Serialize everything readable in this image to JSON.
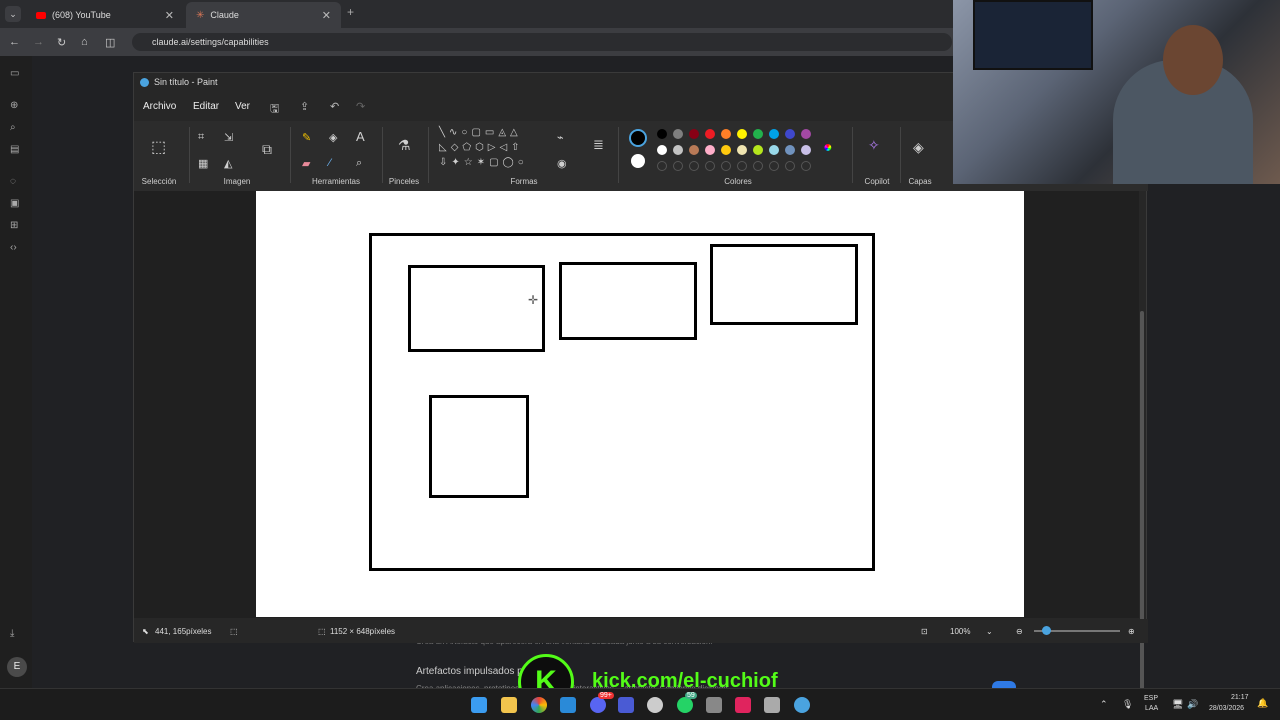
{
  "browser": {
    "tabs": [
      {
        "label": "(608) YouTube",
        "active": false
      },
      {
        "label": "Claude",
        "active": true
      }
    ],
    "url": "claude.ai/settings/capabilities"
  },
  "paint": {
    "title": "Sin título - Paint",
    "menu": [
      "Archivo",
      "Editar",
      "Ver"
    ],
    "groups": {
      "seleccion": "Selección",
      "imagen": "Imagen",
      "herramientas": "Herramientas",
      "pinceles": "Pinceles",
      "formas": "Formas",
      "colores": "Colores",
      "copilot": "Copilot",
      "capas": "Capas"
    },
    "palette_row1": [
      "#000000",
      "#7f7f7f",
      "#880015",
      "#ed1c24",
      "#ff7f27",
      "#fff200",
      "#22b14c",
      "#00a2e8",
      "#3f48cc",
      "#a349a4"
    ],
    "palette_row2": [
      "#ffffff",
      "#c3c3c3",
      "#b97a57",
      "#ffaec9",
      "#ffc90e",
      "#efe4b0",
      "#b5e61d",
      "#99d9ea",
      "#7092be",
      "#c8bfe7"
    ],
    "status": {
      "cursor_pos": "441, 165píxeles",
      "canvas_size": "1152 × 648píxeles",
      "zoom": "100%"
    }
  },
  "page_behind": {
    "line1": "Crea un Artefacto que aparecerá en una ventana dedicada junto a su conversación.",
    "heading": "Artefactos impulsados por",
    "line2": "Crea aplicaciones, prototipos y documentos interactivos… artefacto. Comience diciendo"
  },
  "overlay": {
    "kick_text": "kick.com/el-cuchiof",
    "kick_logo": "K"
  },
  "taskbar": {
    "lang_top": "ESP",
    "lang_bottom": "LAA",
    "time": "21:17",
    "date": "28/03/2026",
    "badge_discord": "99+",
    "badge_whatsapp": "59"
  },
  "sidebar": {
    "avatar": "E"
  }
}
